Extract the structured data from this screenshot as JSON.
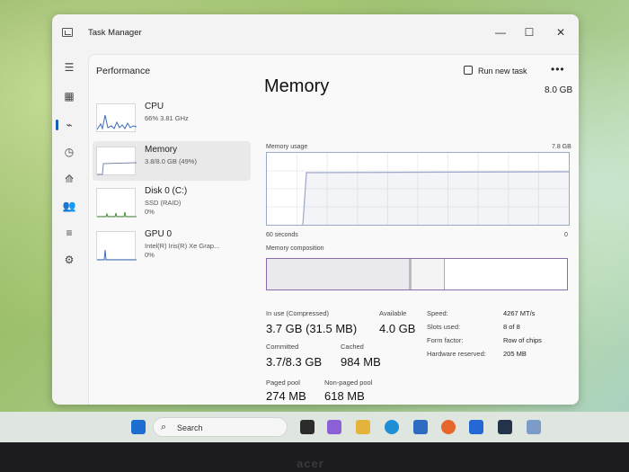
{
  "window": {
    "title": "Task Manager",
    "minimize": "—",
    "maximize": "☐",
    "close": "✕"
  },
  "header": {
    "section": "Performance",
    "run_task": "Run new task",
    "more": "•••"
  },
  "rail": {
    "icons": [
      "hamburger-icon",
      "processes-icon",
      "performance-icon",
      "app-history-icon",
      "startup-icon",
      "users-icon",
      "details-icon",
      "services-icon"
    ]
  },
  "sidebar": {
    "items": [
      {
        "name": "CPU",
        "sub1": "66%  3.81 GHz",
        "sub2": ""
      },
      {
        "name": "Memory",
        "sub1": "3.8/8.0 GB (49%)",
        "sub2": ""
      },
      {
        "name": "Disk 0 (C:)",
        "sub1": "SSD (RAID)",
        "sub2": "0%"
      },
      {
        "name": "GPU 0",
        "sub1": "Intel(R) Iris(R) Xe Grap...",
        "sub2": "0%"
      }
    ]
  },
  "main": {
    "title": "Memory",
    "total": "8.0 GB",
    "usage_label": "Memory usage",
    "usage_max": "7.8 GB",
    "axis_left": "60 seconds",
    "axis_right": "0",
    "composition_label": "Memory composition",
    "usage_level": 0.49
  },
  "stats": {
    "in_use_label": "In use (Compressed)",
    "in_use": "3.7 GB (31.5 MB)",
    "available_label": "Available",
    "available": "4.0 GB",
    "committed_label": "Committed",
    "committed": "3.7/8.3 GB",
    "cached_label": "Cached",
    "cached": "984 MB",
    "paged_label": "Paged pool",
    "paged": "274 MB",
    "nonpaged_label": "Non-paged pool",
    "nonpaged": "618 MB"
  },
  "details": [
    {
      "label": "Speed:",
      "value": "4267 MT/s"
    },
    {
      "label": "Slots used:",
      "value": "8 of 8"
    },
    {
      "label": "Form factor:",
      "value": "Row of chips"
    },
    {
      "label": "Hardware reserved:",
      "value": "205 MB"
    }
  ],
  "taskbar": {
    "search": "Search"
  },
  "bezel": {
    "brand": "acer"
  },
  "colors": {
    "accent": "#1a5fb4",
    "memory_line": "#9aa7c9",
    "composition_border": "#8a6bb1"
  }
}
